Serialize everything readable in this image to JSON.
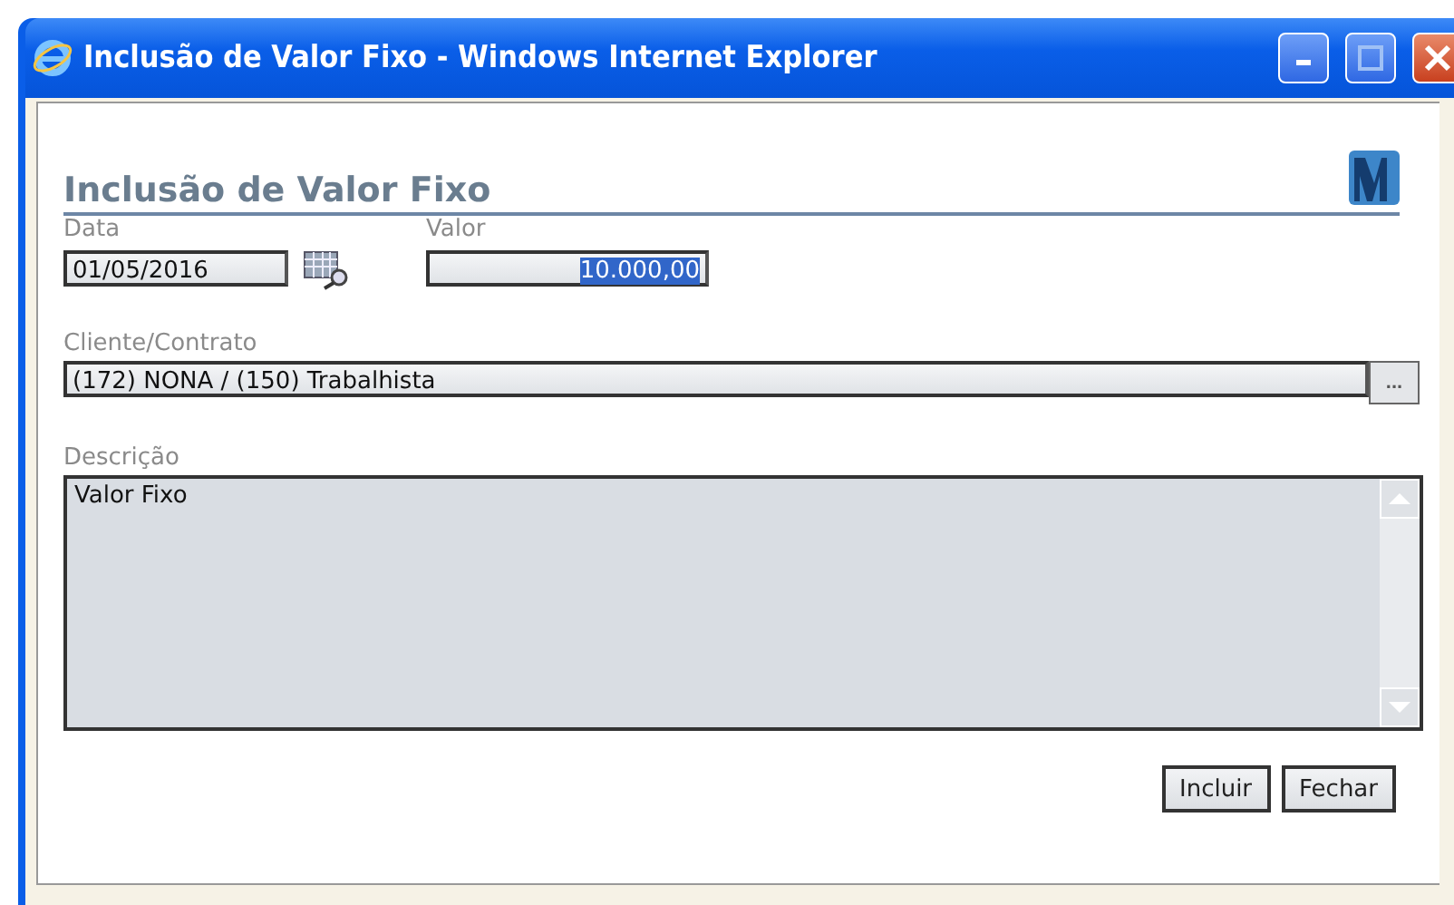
{
  "window": {
    "title": "Inclusão de Valor Fixo - Windows Internet Explorer"
  },
  "form": {
    "heading": "Inclusão de Valor Fixo",
    "date": {
      "label": "Data",
      "value": "01/05/2016"
    },
    "amount": {
      "label": "Valor",
      "value": "10.000,00",
      "selected": true
    },
    "client": {
      "label": "Cliente/Contrato",
      "value": "(172) NONA / (150) Trabalhista",
      "lookup_button": "..."
    },
    "description": {
      "label": "Descrição",
      "value": "Valor Fixo"
    },
    "buttons": [
      "Incluir",
      "Fechar"
    ]
  }
}
